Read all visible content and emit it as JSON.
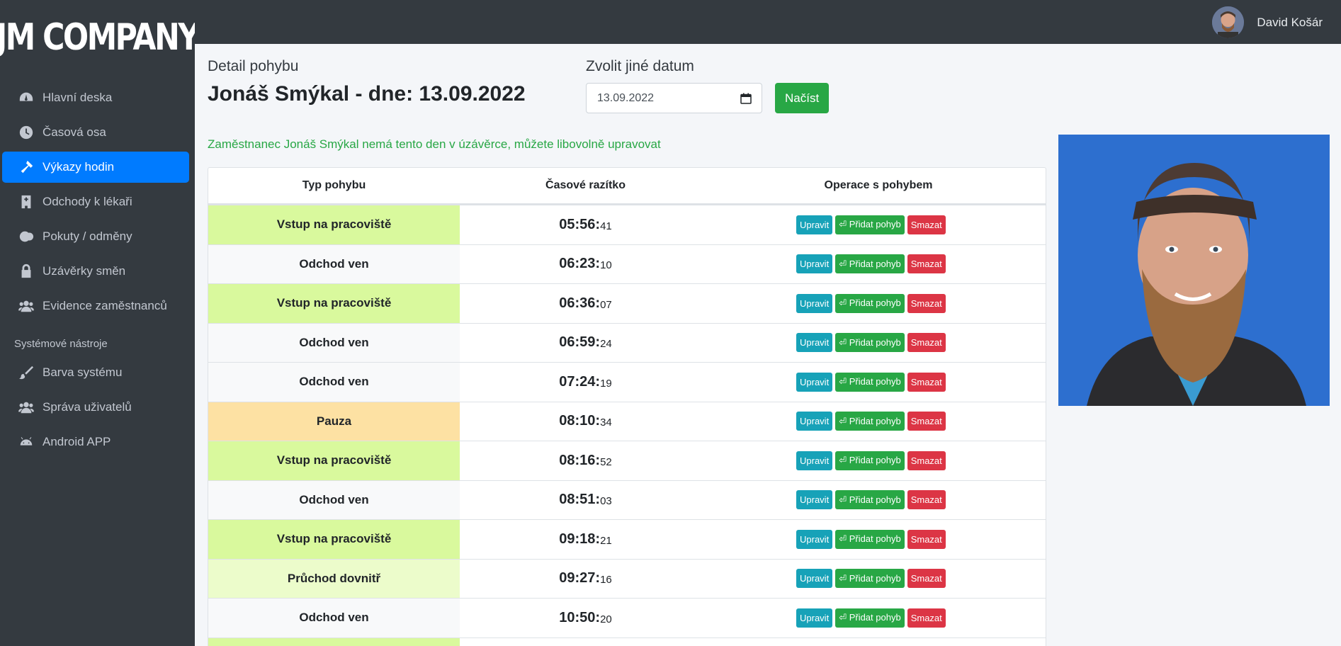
{
  "brand": "JM COMPANY",
  "user": {
    "name": "David Košár"
  },
  "sidebar": {
    "items": [
      {
        "label": "Hlavní deska",
        "icon": "dashboard-icon",
        "active": false
      },
      {
        "label": "Časová osa",
        "icon": "clock-icon",
        "active": false
      },
      {
        "label": "Výkazy hodin",
        "icon": "hammer-icon",
        "active": true
      },
      {
        "label": "Odchody k lékaři",
        "icon": "hospital-icon",
        "active": false
      },
      {
        "label": "Pokuty / odměny",
        "icon": "coins-icon",
        "active": false
      },
      {
        "label": "Uzávěrky směn",
        "icon": "lock-icon",
        "active": false
      },
      {
        "label": "Evidence zaměstnanců",
        "icon": "users-icon",
        "active": false
      }
    ],
    "tools_header": "Systémové nástroje",
    "tools": [
      {
        "label": "Barva systému",
        "icon": "brush-icon"
      },
      {
        "label": "Správa uživatelů",
        "icon": "users-icon"
      },
      {
        "label": "Android APP",
        "icon": "android-icon"
      }
    ]
  },
  "header": {
    "detail_label": "Detail pohybu",
    "title": "Jonáš Smýkal - dne: 13.09.2022",
    "date_label": "Zvolit jiné datum",
    "date_value": "13.09.2022",
    "load_button": "Načíst"
  },
  "notice": "Zaměstnanec Jonáš Smýkal nemá tento den v úzávěrce, můžete libovolně upravovat",
  "table": {
    "columns": [
      "Typ pohybu",
      "Časové razítko",
      "Operace s pohybem"
    ],
    "buttons": {
      "edit": "Upravit",
      "add": "⏎ Přidat pohyb",
      "delete": "Smazat"
    },
    "rows": [
      {
        "type": "Vstup na pracoviště",
        "kind": "in",
        "time": "05:56:",
        "sec": "41"
      },
      {
        "type": "Odchod ven",
        "kind": "out",
        "time": "06:23:",
        "sec": "10"
      },
      {
        "type": "Vstup na pracoviště",
        "kind": "in",
        "time": "06:36:",
        "sec": "07"
      },
      {
        "type": "Odchod ven",
        "kind": "out",
        "time": "06:59:",
        "sec": "24"
      },
      {
        "type": "Odchod ven",
        "kind": "out",
        "time": "07:24:",
        "sec": "19"
      },
      {
        "type": "Pauza",
        "kind": "pause",
        "time": "08:10:",
        "sec": "34"
      },
      {
        "type": "Vstup na pracoviště",
        "kind": "in",
        "time": "08:16:",
        "sec": "52"
      },
      {
        "type": "Odchod ven",
        "kind": "out",
        "time": "08:51:",
        "sec": "03"
      },
      {
        "type": "Vstup na pracoviště",
        "kind": "in",
        "time": "09:18:",
        "sec": "21"
      },
      {
        "type": "Průchod dovnitř",
        "kind": "pass",
        "time": "09:27:",
        "sec": "16"
      },
      {
        "type": "Odchod ven",
        "kind": "out",
        "time": "10:50:",
        "sec": "20"
      },
      {
        "type": "",
        "kind": "in",
        "time": "",
        "sec": ""
      }
    ]
  },
  "colors": {
    "sidebar_bg": "#343a40",
    "active": "#007bff",
    "in": "#d9f99d",
    "out": "#f8f9fa",
    "pause": "#fde1a3",
    "pass": "#ecfccb"
  }
}
